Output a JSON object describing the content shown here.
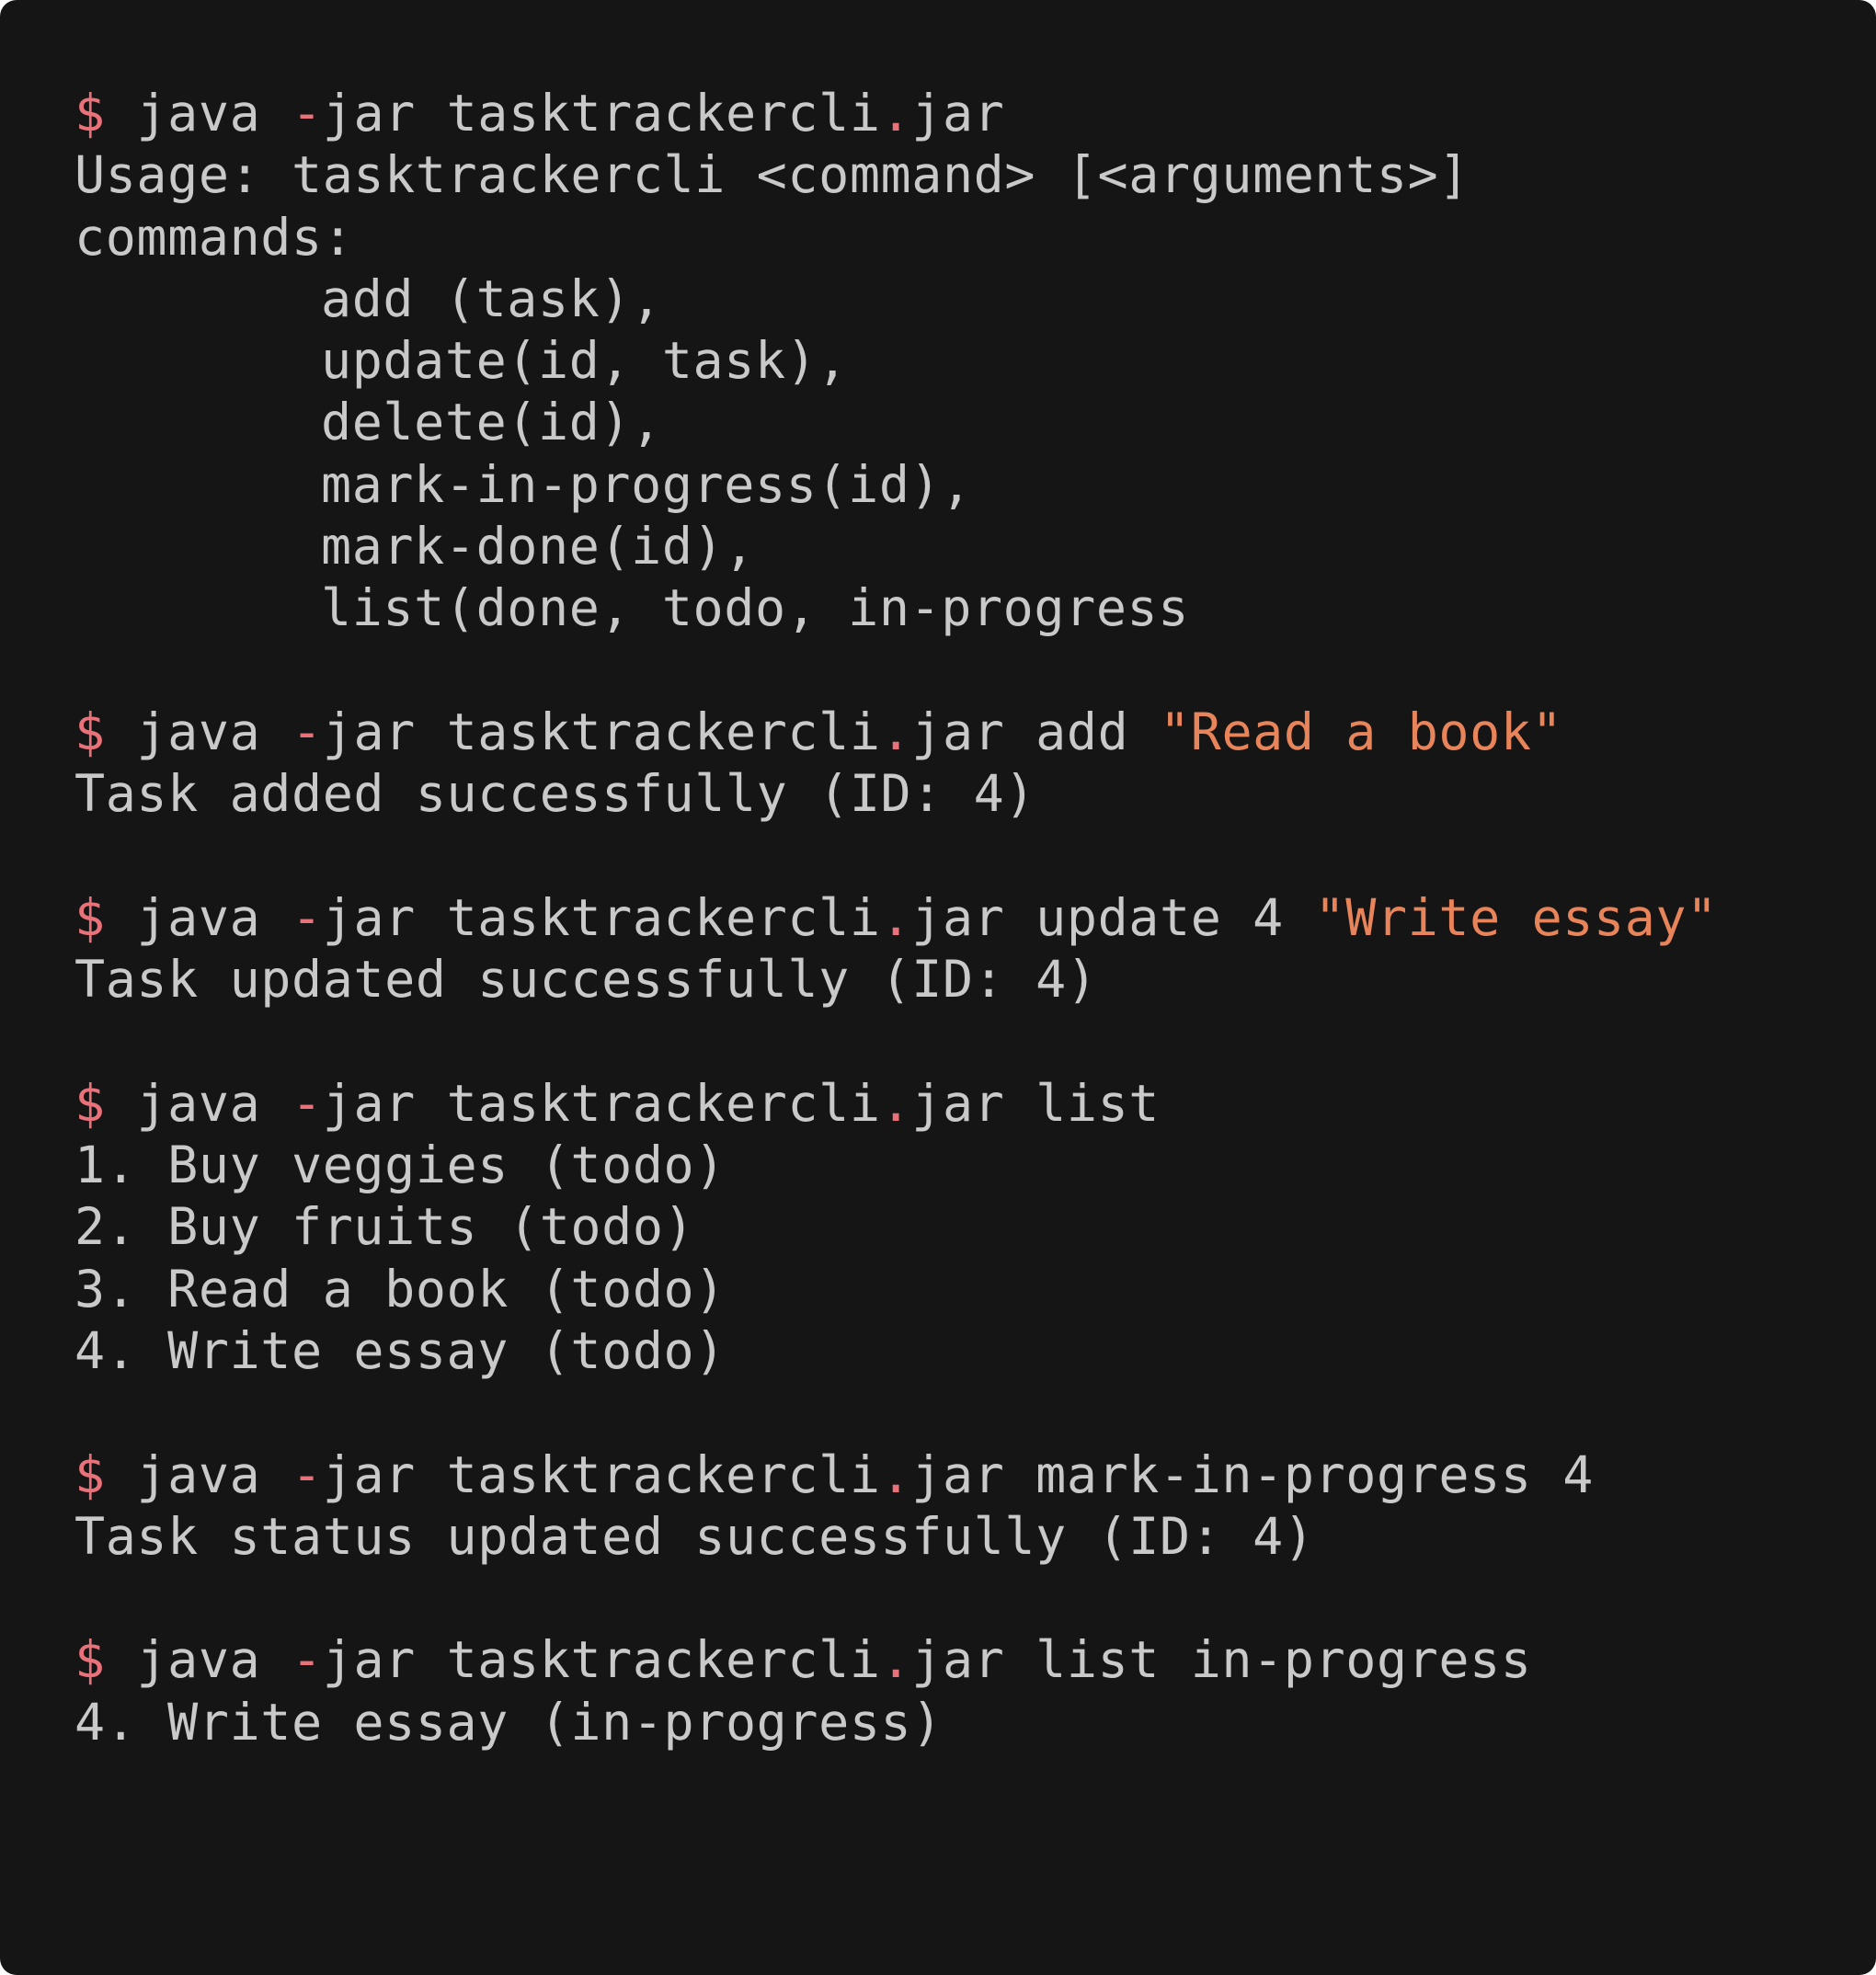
{
  "colors": {
    "background": "#151515",
    "text": "#c9c9c9",
    "prompt": "#e9727a",
    "string": "#e8845a"
  },
  "terminal": {
    "prompt_symbol": "$",
    "jar_word": "java",
    "jar_flag": "-jar",
    "jar_name": "tasktrackercli",
    "jar_dot": ".",
    "jar_ext": "jar",
    "blocks": [
      {
        "args": "",
        "string_arg": "",
        "output": [
          "Usage: tasktrackercli <command> [<arguments>]",
          "commands:"
        ],
        "indented": [
          "add (task),",
          "update(id, task),",
          "delete(id),",
          "mark-in-progress(id),",
          "mark-done(id),",
          "list(done, todo, in-progress"
        ]
      },
      {
        "args": "add",
        "string_arg": "\"Read a book\"",
        "output": [
          "Task added successfully (ID: 4)"
        ]
      },
      {
        "args": "update 4",
        "string_arg": "\"Write essay\"",
        "output": [
          "Task updated successfully (ID: 4)"
        ]
      },
      {
        "args": "list",
        "string_arg": "",
        "output": [
          "1. Buy veggies (todo)",
          "2. Buy fruits (todo)",
          "3. Read a book (todo)",
          "4. Write essay (todo)"
        ]
      },
      {
        "args": "mark-in-progress 4",
        "string_arg": "",
        "output": [
          "Task status updated successfully (ID: 4)"
        ]
      },
      {
        "args": "list in-progress",
        "string_arg": "",
        "output": [
          "4. Write essay (in-progress)"
        ]
      }
    ]
  }
}
